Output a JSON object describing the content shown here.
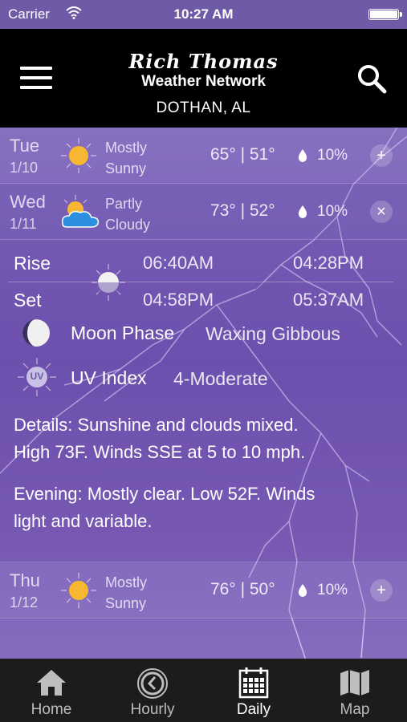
{
  "status_bar": {
    "carrier": "Carrier",
    "time": "10:27 AM"
  },
  "header": {
    "logo_script": "Rich Thomas",
    "logo_sub": "Weather Network",
    "location": "DOTHAN, AL"
  },
  "days": [
    {
      "day": "Tue",
      "date": "1/10",
      "condition_line1": "Mostly",
      "condition_line2": "Sunny",
      "icon": "sun-icon",
      "temps": "65° | 51°",
      "precip": "10%",
      "toggle": "+"
    },
    {
      "day": "Wed",
      "date": "1/11",
      "condition_line1": "Partly",
      "condition_line2": "Cloudy",
      "icon": "partly-cloudy-icon",
      "temps": "73° | 52°",
      "precip": "10%",
      "toggle": "×"
    },
    {
      "day": "Thu",
      "date": "1/12",
      "condition_line1": "Mostly",
      "condition_line2": "Sunny",
      "icon": "sun-icon",
      "temps": "76° | 50°",
      "precip": "10%",
      "toggle": "+"
    }
  ],
  "details": {
    "rise_label": "Rise",
    "set_label": "Set",
    "sunrise": "06:40AM",
    "sunset": "04:58PM",
    "moonrise": "04:28PM",
    "moonset": "05:37AM",
    "moon_phase_label": "Moon Phase",
    "moon_phase_value": "Waxing Gibbous",
    "uv_label": "UV Index",
    "uv_value": "4-Moderate",
    "uv_badge": "UV",
    "details_line1": "Details: Sunshine and clouds mixed.",
    "details_line2": "High 73F. Winds SSE at 5 to 10 mph.",
    "evening_line1": "Evening: Mostly clear. Low 52F. Winds",
    "evening_line2": "light and variable."
  },
  "tab_bar": {
    "tabs": [
      {
        "label": "Home",
        "icon": "home-icon"
      },
      {
        "label": "Hourly",
        "icon": "clock-icon"
      },
      {
        "label": "Daily",
        "icon": "calendar-icon",
        "active": true
      },
      {
        "label": "Map",
        "icon": "map-icon"
      }
    ]
  },
  "colors": {
    "accent": "#7a5fb8",
    "header_bg": "#000000",
    "tab_active": "#ffffff",
    "tab_inactive": "#bdbdbd"
  }
}
